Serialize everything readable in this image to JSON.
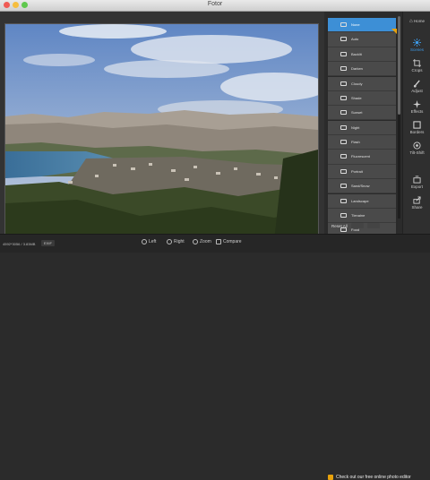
{
  "window": {
    "title": "Fotor"
  },
  "scenes": {
    "items": [
      {
        "label": "None",
        "active": true
      },
      {
        "label": "Auto"
      },
      {
        "label": "Backlit"
      },
      {
        "label": "Darken"
      },
      {
        "label": "Cloudy"
      },
      {
        "label": "Shade"
      },
      {
        "label": "Sunset"
      },
      {
        "label": "Night"
      },
      {
        "label": "Flash"
      },
      {
        "label": "Fluorescent"
      },
      {
        "label": "Portrait"
      },
      {
        "label": "Sand/Snow"
      },
      {
        "label": "Landscape"
      },
      {
        "label": "Tlenaine"
      },
      {
        "label": "Food"
      }
    ],
    "reset_label": "Reset All"
  },
  "sidebar": {
    "home": "Home",
    "scenes": "Scenes",
    "crops": "Crops",
    "adjust": "Adjust",
    "effects": "Effects",
    "borders": "Borders",
    "tiltshift": "Tilt-Shift",
    "export": "Export",
    "share": "Share"
  },
  "status": {
    "dimensions": "4592*3056 / 3.83MB",
    "exif": "EXIF",
    "left": "Left",
    "right": "Right",
    "zoom": "Zoom",
    "compare": "Compare",
    "promo": "Check out our free online photo editor"
  },
  "colors": {
    "accent": "#3d8fd6",
    "badge": "#e8a20c"
  }
}
